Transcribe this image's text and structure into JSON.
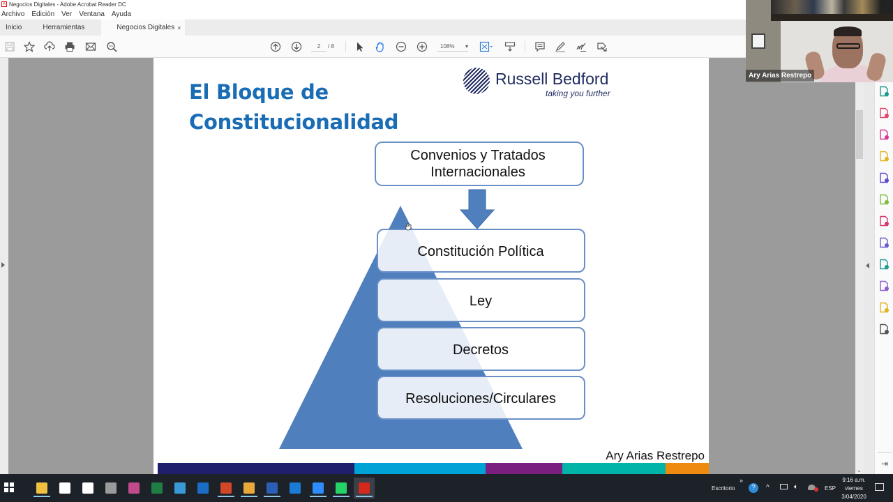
{
  "window": {
    "title": "Negocios Digitales - Adobe Acrobat Reader DC",
    "app_icon": "acrobat-icon"
  },
  "menu": {
    "items": [
      "Archivo",
      "Edición",
      "Ver",
      "Ventana",
      "Ayuda"
    ]
  },
  "tabs": {
    "home": "Inicio",
    "tools": "Herramientas",
    "document": "Negocios Digitales",
    "close": "×"
  },
  "toolbar": {
    "icons_left": [
      "save-icon",
      "bookmark-star-icon",
      "upload-cloud-icon",
      "print-icon",
      "email-icon",
      "search-icon"
    ],
    "page_current": "2",
    "page_total": "/ 8",
    "zoom_level": "108%",
    "zoom_caret": "▾",
    "icons_right": [
      "previous-page-icon",
      "next-page-icon",
      "select-cursor-icon",
      "hand-tool-icon",
      "zoom-out-icon",
      "zoom-in-icon",
      "fit-page-icon",
      "scroll-mode-icon",
      "comment-icon",
      "highlight-icon",
      "sign-icon",
      "share-icon"
    ]
  },
  "slide": {
    "title_line1": "El Bloque de",
    "title_line2": "Constitucionalidad",
    "logo_name": "Russell Bedford",
    "logo_tagline": "taking you further",
    "top_box_line1": "Convenios y Tratados",
    "top_box_line2": "Internacionales",
    "levels": [
      "Constitución Política",
      "Ley",
      "Decretos",
      "Resoluciones/Circulares"
    ],
    "author": "Ary Arias Restrepo",
    "band_colors": [
      "#1f1f6e",
      "#00a3d6",
      "#7a1f80",
      "#00b5a8",
      "#ee8a10"
    ],
    "accent_title": "#1a6cb5",
    "pyramid_color": "#4f7fbd"
  },
  "video": {
    "participant_name": "Ary Arias Restrepo"
  },
  "right_panel": {
    "tools": [
      {
        "name": "create-pdf-icon",
        "color": "#1e9a8f"
      },
      {
        "name": "export-pdf-icon",
        "color": "#e0456a"
      },
      {
        "name": "organize-pages-icon",
        "color": "#d6359a"
      },
      {
        "name": "comment-tool-icon",
        "color": "#e0b41c"
      },
      {
        "name": "combine-files-icon",
        "color": "#5b4ad6"
      },
      {
        "name": "compress-pdf-icon",
        "color": "#7bbd3c"
      },
      {
        "name": "fill-sign-icon",
        "color": "#d6356a"
      },
      {
        "name": "protect-icon",
        "color": "#6b5bd0"
      },
      {
        "name": "scan-ocr-icon",
        "color": "#1e9a8f"
      },
      {
        "name": "request-signature-icon",
        "color": "#8b5bd0"
      },
      {
        "name": "send-comments-icon",
        "color": "#e0b41c"
      },
      {
        "name": "more-tools-icon",
        "color": "#555555"
      }
    ]
  },
  "taskbar": {
    "apps": [
      {
        "name": "file-explorer-icon",
        "color": "#f0c040",
        "running": true
      },
      {
        "name": "home-icon",
        "color": "#ffffff",
        "running": false
      },
      {
        "name": "store-icon",
        "color": "#ffffff",
        "running": false
      },
      {
        "name": "webcam-app-icon",
        "color": "#9a9a9a",
        "running": false
      },
      {
        "name": "photos-app-icon",
        "color": "#c04a8a",
        "running": false
      },
      {
        "name": "excel-icon",
        "color": "#1e7e45",
        "running": false
      },
      {
        "name": "network-app-icon",
        "color": "#3a9ad8",
        "running": false
      },
      {
        "name": "outlook-icon",
        "color": "#1a6cc4",
        "running": false
      },
      {
        "name": "powerpoint-icon",
        "color": "#d24726",
        "running": true
      },
      {
        "name": "chrome-icon",
        "color": "#e8a93a",
        "running": true
      },
      {
        "name": "word-icon",
        "color": "#2b5eb5",
        "running": true
      },
      {
        "name": "edge-icon",
        "color": "#1a7bd6",
        "running": false
      },
      {
        "name": "zoom-icon",
        "color": "#2d8cff",
        "running": true
      },
      {
        "name": "whatsapp-icon",
        "color": "#25d366",
        "running": true
      },
      {
        "name": "acrobat-taskbar-icon",
        "color": "#d42a1e",
        "running": true
      }
    ],
    "desktop_label": "Escritorio",
    "overflow": "»",
    "language": "ESP",
    "time": "9:16 a.m.",
    "day": "viernes",
    "date": "3/04/2020"
  }
}
